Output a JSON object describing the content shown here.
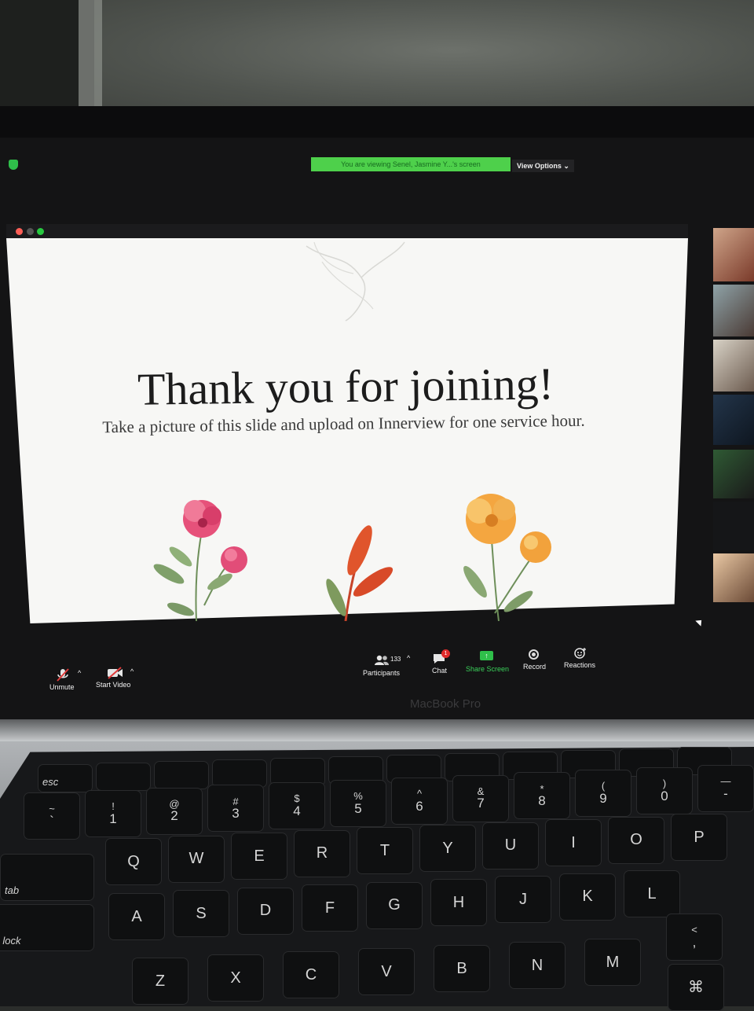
{
  "zoom": {
    "banner_text": "You are viewing Senel, Jasmine Y...'s screen",
    "view_options_label": "View Options",
    "view_options_chevron": "⌄",
    "slide": {
      "title": "Thank you for joining!",
      "subtitle": "Take a picture of this slide and upload on Innerview for one service hour."
    },
    "toolbar": {
      "unmute_label": "Unmute",
      "start_video_label": "Start Video",
      "participants_label": "Participants",
      "participants_count": "133",
      "chat_label": "Chat",
      "chat_badge": "1",
      "share_screen_label": "Share Screen",
      "share_icon_glyph": "↑",
      "record_label": "Record",
      "reactions_label": "Reactions",
      "caret": "^"
    },
    "colors": {
      "banner_green": "#4ed04b",
      "share_green": "#2fbf4a",
      "badge_red": "#e02b2b",
      "window_red": "#fe5f57",
      "window_yellow": "#febc2e",
      "window_green": "#28c840"
    }
  },
  "laptop": {
    "label": "MacBook Pro"
  },
  "keyboard": {
    "esc": "esc",
    "tab": "tab",
    "caps": "os lock",
    "number_row": [
      {
        "top": "~",
        "bot": "`"
      },
      {
        "top": "!",
        "bot": "1"
      },
      {
        "top": "@",
        "bot": "2"
      },
      {
        "top": "#",
        "bot": "3"
      },
      {
        "top": "$",
        "bot": "4"
      },
      {
        "top": "%",
        "bot": "5"
      },
      {
        "top": "^",
        "bot": "6"
      },
      {
        "top": "&",
        "bot": "7"
      },
      {
        "top": "*",
        "bot": "8"
      },
      {
        "top": "(",
        "bot": "9"
      },
      {
        "top": ")",
        "bot": "0"
      },
      {
        "top": "—",
        "bot": "-"
      }
    ],
    "row_q": [
      "Q",
      "W",
      "E",
      "R",
      "T",
      "Y",
      "U",
      "I",
      "O",
      "P"
    ],
    "row_a": [
      "A",
      "S",
      "D",
      "F",
      "G",
      "H",
      "J",
      "K",
      "L"
    ],
    "row_z": [
      "Z",
      "X",
      "C",
      "V",
      "B",
      "N",
      "M"
    ],
    "comma": {
      "top": "<",
      "bot": ","
    },
    "cmd": "⌘"
  }
}
